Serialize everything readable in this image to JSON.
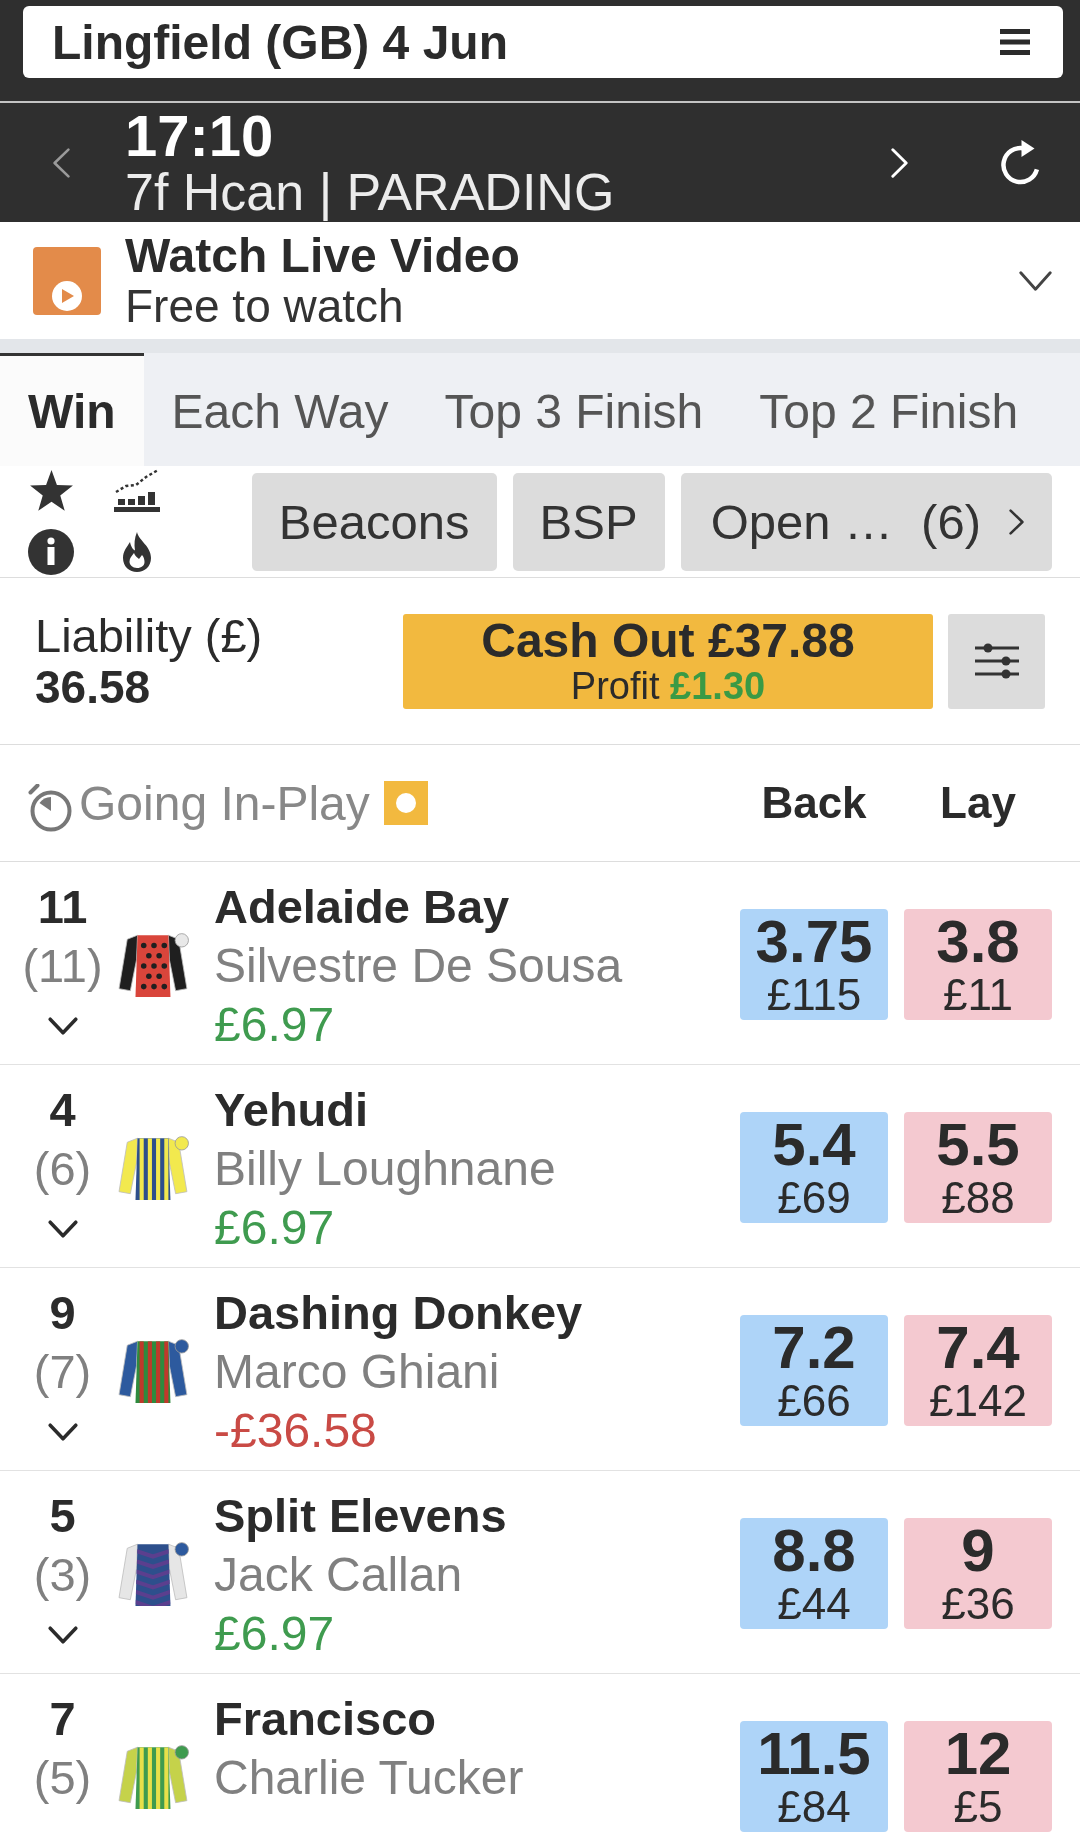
{
  "header": {
    "title": "Lingfield (GB) 4 Jun"
  },
  "race": {
    "time": "17:10",
    "status": "7f Hcan | PARADING"
  },
  "video": {
    "title": "Watch Live Video",
    "subtitle": "Free to watch"
  },
  "tabs": [
    {
      "label": "Win",
      "selected": true
    },
    {
      "label": "Each Way",
      "selected": false
    },
    {
      "label": "Top 3 Finish",
      "selected": false
    },
    {
      "label": "Top 2 Finish",
      "selected": false
    }
  ],
  "filters": [
    {
      "kind": "plain",
      "label": "Beacons"
    },
    {
      "kind": "plain",
      "label": "BSP"
    },
    {
      "kind": "more",
      "label": "Open …",
      "count": "(6)"
    }
  ],
  "liability": {
    "label": "Liability (£)",
    "value": "36.58"
  },
  "cash_out": {
    "label": "Cash Out £37.88",
    "profit_label": "Profit",
    "profit_value": "£1.30"
  },
  "market_header": {
    "status": "Going In-Play",
    "back_label": "Back",
    "lay_label": "Lay"
  },
  "runners": [
    {
      "number": "11",
      "stall": "(11)",
      "name": "Adelaide Bay",
      "jockey": "Silvestre De Sousa",
      "pnl": {
        "kind": "profit",
        "text": "£6.97"
      },
      "silk": [
        {
          "kind": "sleeves",
          "color": "#1f1f1f"
        },
        {
          "kind": "body",
          "color": "#d9453b"
        },
        {
          "kind": "spots",
          "color": "#1f1f1f"
        },
        {
          "kind": "cap",
          "color": "#e8e8e8"
        }
      ],
      "back": {
        "price": "3.75",
        "amount": "£115"
      },
      "lay": {
        "price": "3.8",
        "amount": "£11"
      }
    },
    {
      "number": "4",
      "stall": "(6)",
      "name": "Yehudi",
      "jockey": "Billy Loughnane",
      "pnl": {
        "kind": "profit",
        "text": "£6.97"
      },
      "silk": [
        {
          "kind": "sleeves",
          "color": "#f2e94e"
        },
        {
          "kind": "body",
          "color": "#2d4f8c"
        },
        {
          "kind": "stripes",
          "color": "#f2e94e"
        },
        {
          "kind": "cap",
          "color": "#f2e94e"
        }
      ],
      "back": {
        "price": "5.4",
        "amount": "£69"
      },
      "lay": {
        "price": "5.5",
        "amount": "£88"
      }
    },
    {
      "number": "9",
      "stall": "(7)",
      "name": "Dashing Donkey",
      "jockey": "Marco Ghiani",
      "pnl": {
        "kind": "loss",
        "text": "-£36.58"
      },
      "silk": [
        {
          "kind": "sleeves",
          "color": "#2d5a9e"
        },
        {
          "kind": "body",
          "color": "#2e8b3e"
        },
        {
          "kind": "stripes",
          "color": "#c0392b"
        },
        {
          "kind": "cap",
          "color": "#2d5a9e"
        }
      ],
      "back": {
        "price": "7.2",
        "amount": "£66"
      },
      "lay": {
        "price": "7.4",
        "amount": "£142"
      }
    },
    {
      "number": "5",
      "stall": "(3)",
      "name": "Split Elevens",
      "jockey": "Jack Callan",
      "pnl": {
        "kind": "profit",
        "text": "£6.97"
      },
      "silk": [
        {
          "kind": "sleeves",
          "color": "#e6e6e6"
        },
        {
          "kind": "body",
          "color": "#2d4f8c"
        },
        {
          "kind": "chevrons",
          "color": "#5b3f8e"
        },
        {
          "kind": "cap",
          "color": "#2d5a9e"
        }
      ],
      "back": {
        "price": "8.8",
        "amount": "£44"
      },
      "lay": {
        "price": "9",
        "amount": "£36"
      }
    },
    {
      "number": "7",
      "stall": "(5)",
      "name": "Francisco",
      "jockey": "Charlie Tucker",
      "silk": [
        {
          "kind": "sleeves",
          "color": "#c5d24a"
        },
        {
          "kind": "body",
          "color": "#3f9b4f"
        },
        {
          "kind": "stripes",
          "color": "#e8e04a"
        },
        {
          "kind": "cap",
          "color": "#3f9b4f"
        }
      ],
      "back": {
        "price": "11.5",
        "amount": "£84"
      },
      "lay": {
        "price": "12",
        "amount": "£5"
      }
    }
  ]
}
